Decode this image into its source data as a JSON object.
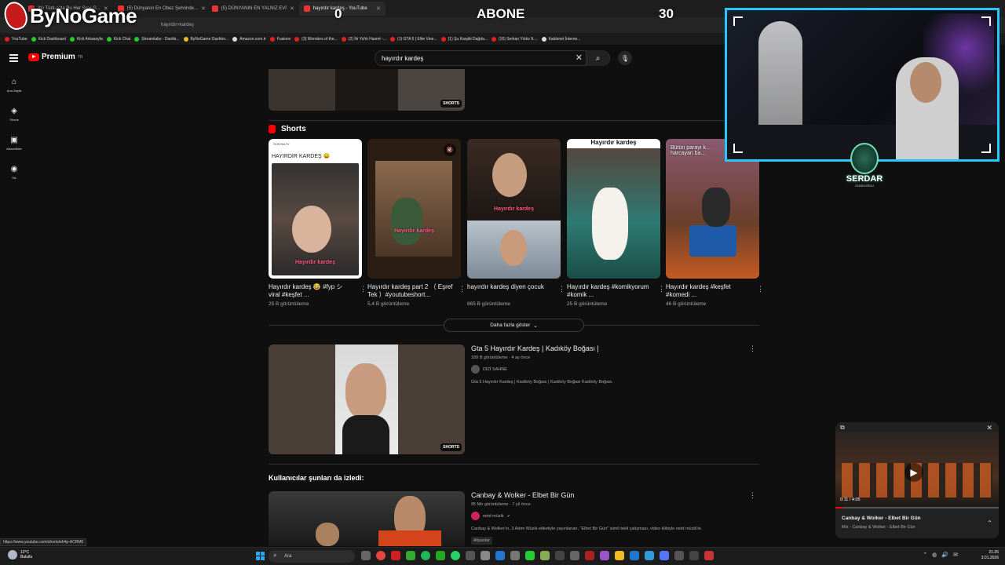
{
  "browser": {
    "tabs": [
      {
        "title": "Ihlı Türk-a'da Bu Her Şeyi G..."
      },
      {
        "title": "(5) Dünyanın En Obez Şehrinde..."
      },
      {
        "title": "(5) DÜNYANIN EN YALNIZ EVİ"
      },
      {
        "title": "hayırdır kardeş - YouTube"
      }
    ],
    "address": "hayırdır+kardeş",
    "bookmarks": [
      "YouTube",
      "Kick Dashboard",
      "Kick Arkasayfa",
      "Kick Chat",
      "Streamlabs - Dashb...",
      "ByNoGame Dashbo...",
      "Amazon.com.tr",
      "Fusionv",
      "(3) Wonders of the...",
      "(2) İki Yıl/ık Hasret -...",
      "(1) GTA 5 | Elite Vine...",
      "(1) Şu Karşiki Dağda...",
      "(16) Serkan Yıldız ft....",
      "Kablonet İnterne..."
    ]
  },
  "overlay": {
    "logo": "ByNoGame",
    "abone_left": "0",
    "abone_label": "ABONE",
    "abone_right": "30",
    "streamer_name": "SERDAR",
    "streamer_sub": "GÜNDOĞDU"
  },
  "header": {
    "brand": "Premium",
    "region": "TR",
    "search_value": "hayırdır kardeş"
  },
  "guide": [
    {
      "icon": "home-icon",
      "glyph": "⌂",
      "label": "Ana Sayfa"
    },
    {
      "icon": "shorts-icon",
      "glyph": "◈",
      "label": "Shorts"
    },
    {
      "icon": "subscriptions-icon",
      "glyph": "▣",
      "label": "Abonelikler"
    },
    {
      "icon": "you-icon",
      "glyph": "◉",
      "label": "Siz"
    }
  ],
  "top_video": {
    "badge": "SHORTS"
  },
  "shorts": {
    "heading": "Shorts",
    "items": [
      {
        "title": "Hayırdır kardeş 😂 #fyp シ viral #keşfet ...",
        "views": "25 B görüntüleme",
        "caption": "Hayırdır kardeş",
        "top_text": "HAYIRDIR KARDEŞ 😄"
      },
      {
        "title": "Hayırdır kardeş part 2 （ Eşref Tek ）#youtubeshort...",
        "views": "5,4 B görüntüleme",
        "caption": "Hayırdır kardeş"
      },
      {
        "title": "hayırdır kardeş diyen çocuk",
        "views": "865 B görüntüleme",
        "caption": "Hayırdır kardeş"
      },
      {
        "title": "Hayırdır kardeş #komikyorum #komik ...",
        "views": "25 B görüntüleme",
        "top_text": "Hayırdır kardeş"
      },
      {
        "title": "Hayırdır kardeş #keşfet #komedi ...",
        "views": "46 B görüntüleme",
        "top_text": "Bütün parayı k... harcayan ba..."
      }
    ],
    "show_more": "Daha fazla göster"
  },
  "videos": [
    {
      "title": "Gta 5 Hayırdır Kardeş | Kadıköy Boğası |",
      "stats": "189 B görüntüleme · 4 ay önce",
      "channel": "DİZİ SAHNE",
      "desc": "Gta 5 Hayırdır Kardeş | Kadıköy Boğası | Kadıköy Boğası Kadıköy Boğası.",
      "badge": "SHORTS"
    },
    {
      "title": "Canbay & Wolker - Elbet Bir Gün",
      "stats": "95 Mn görüntüleme · 7 yıl önce",
      "channel": "netd müzik",
      "desc": "Canbay & Wolker'ın, 3 Adım Müzik etiketiyle yayınlanan, \"Elbet Bir Gün\" isimli tekli çalışması, video klibiyle netd müzik'te.",
      "tag": "Altyazılar"
    }
  ],
  "section_also_watched": "Kullanıcılar şunları da izledi:",
  "miniplayer": {
    "time": "0:11 / 4:05",
    "progress": 0.045,
    "title": "Canbay & Wolker - Elbet Bir Gün",
    "subtitle": "Mix - Canbay & Wolker - Elbet Bir Gün"
  },
  "status_url": "https://www.youtube.com/shorts/eh4p-ACRM0",
  "taskbar": {
    "temp": "12°C",
    "weather": "Bulutlu",
    "search": "Ara",
    "time": "21:25",
    "date": "3.01.2026"
  }
}
